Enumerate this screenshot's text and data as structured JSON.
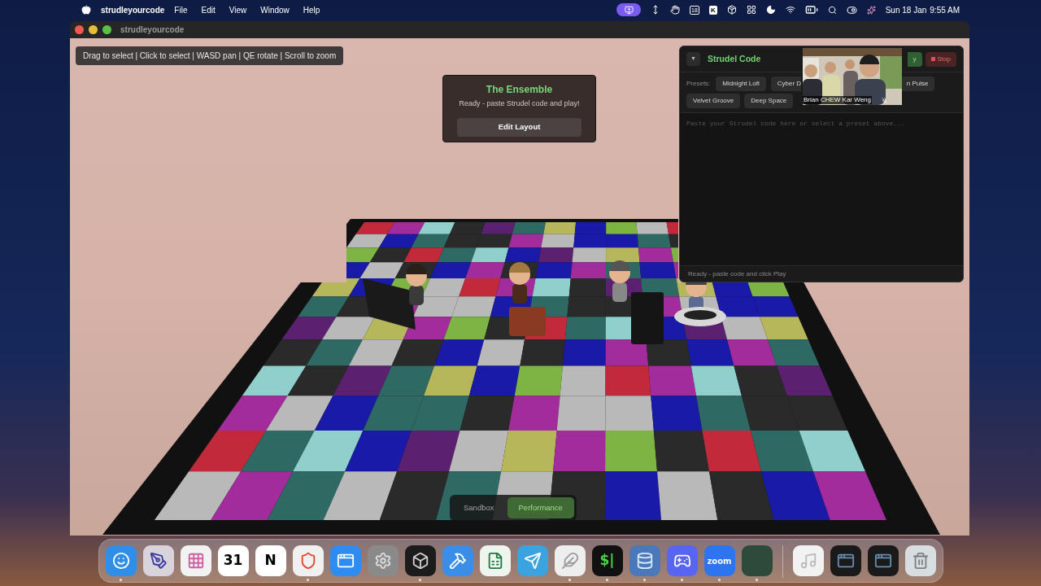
{
  "menu_bar": {
    "app": "strudleyourcode",
    "menus": [
      "File",
      "Edit",
      "View",
      "Window",
      "Help"
    ],
    "calendar_glyph": "18",
    "k_glyph": "K",
    "date": "Sun 18 Jan",
    "time": "9:55 AM"
  },
  "window": {
    "title": "strudleyourcode"
  },
  "hint": "Drag to select | Click to select | WASD pan | QE rotate | Scroll to zoom",
  "ensemble": {
    "title": "The Ensemble",
    "status": "Ready - paste Strudel code and play!",
    "button": "Edit Layout"
  },
  "strudel_panel": {
    "toggle": "▼",
    "title": "Strudel Code",
    "play_button": "y",
    "stop_button": "Stop",
    "presets_label": "Presets:",
    "presets": [
      {
        "label": "Midnight Lofi"
      },
      {
        "label": "Cyber D"
      },
      {
        "label": "n Pulse"
      },
      {
        "label": "Velvet Groove"
      },
      {
        "label": "Deep Space"
      }
    ],
    "placeholder": "Paste your Strudel code here or select a preset above...",
    "status": "Ready - paste code and click Play"
  },
  "video_call": {
    "kind": "picture",
    "name": "Brian CHEW Kar Weng"
  },
  "modes": [
    {
      "label": "Sandbox",
      "selected": false
    },
    {
      "label": "Performance",
      "selected": true
    }
  ],
  "dock": [
    {
      "kind": "finder",
      "running": true
    },
    {
      "kind": "affinity",
      "running": false
    },
    {
      "kind": "launchpad",
      "running": false
    },
    {
      "kind": "calendar",
      "glyph": "31",
      "running": false
    },
    {
      "kind": "notion",
      "glyph": "N",
      "running": false
    },
    {
      "kind": "brave",
      "running": true
    },
    {
      "kind": "appstore",
      "running": false
    },
    {
      "kind": "settings",
      "running": false
    },
    {
      "kind": "cube",
      "running": true
    },
    {
      "kind": "xcode",
      "running": false
    },
    {
      "kind": "excel",
      "running": false
    },
    {
      "kind": "telegram",
      "running": false
    },
    {
      "kind": "feather",
      "running": true
    },
    {
      "kind": "terminal",
      "glyph": "$|",
      "running": true
    },
    {
      "kind": "database",
      "running": true
    },
    {
      "kind": "discord",
      "running": true
    },
    {
      "kind": "zoom",
      "glyph": "zoom",
      "running": true
    },
    {
      "kind": "greentile",
      "running": true
    },
    {
      "kind": "divider"
    },
    {
      "kind": "music",
      "running": false
    },
    {
      "kind": "thumbnail",
      "running": false
    },
    {
      "kind": "thumbnail",
      "running": false
    },
    {
      "kind": "trash",
      "running": false
    }
  ]
}
